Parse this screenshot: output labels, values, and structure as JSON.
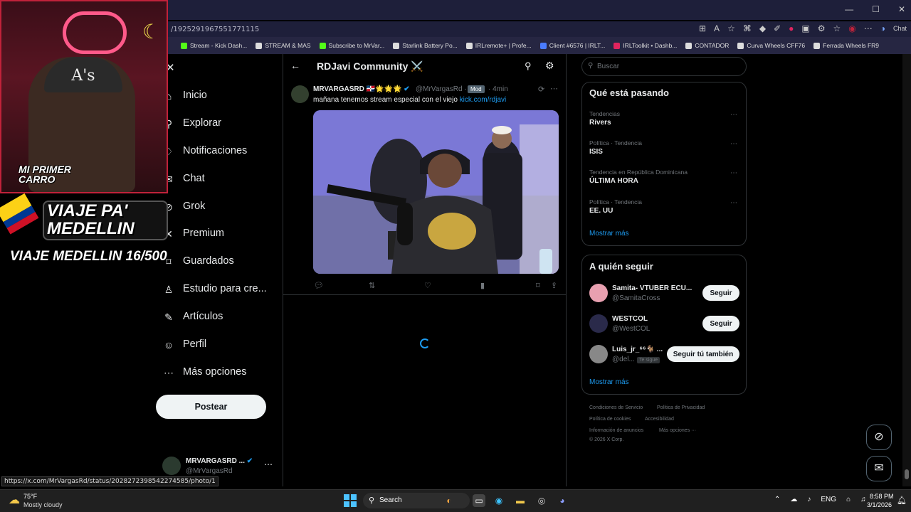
{
  "browser": {
    "url": "/1925291967551771115",
    "window_controls": [
      "—",
      "☐",
      "✕"
    ],
    "chat_label": "Chat",
    "bookmarks": [
      {
        "label": "Stream - Kick Dash...",
        "color": "#53fc18"
      },
      {
        "label": "STREAM & MAS",
        "color": "#dddddd"
      },
      {
        "label": "Subscribe to MrVar...",
        "color": "#53fc18"
      },
      {
        "label": "Starlink Battery Po...",
        "color": "#dddddd"
      },
      {
        "label": "IRLremote+ | Profe...",
        "color": "#dddddd"
      },
      {
        "label": "Client #6576 | IRLT...",
        "color": "#4a7cff"
      },
      {
        "label": "IRLToolkit • Dashb...",
        "color": "#e0245e"
      },
      {
        "label": "CONTADOR",
        "color": "#dddddd"
      },
      {
        "label": "Curva Wheels CFF76",
        "color": "#dddddd"
      },
      {
        "label": "Ferrada Wheels FR9",
        "color": "#dddddd"
      }
    ]
  },
  "nav": {
    "items": [
      {
        "label": "Inicio",
        "icon": "home-icon",
        "glyph": "⌂"
      },
      {
        "label": "Explorar",
        "icon": "search-icon",
        "glyph": "⚲"
      },
      {
        "label": "Notificaciones",
        "icon": "bell-icon",
        "glyph": "♢"
      },
      {
        "label": "Chat",
        "icon": "chat-icon",
        "glyph": "✉"
      },
      {
        "label": "Grok",
        "icon": "grok-icon",
        "glyph": "⊘"
      },
      {
        "label": "Premium",
        "icon": "x-premium-icon",
        "glyph": "✕"
      },
      {
        "label": "Guardados",
        "icon": "bookmark-icon",
        "glyph": "⌑"
      },
      {
        "label": "Estudio para cre...",
        "icon": "studio-icon",
        "glyph": "♙"
      },
      {
        "label": "Artículos",
        "icon": "article-icon",
        "glyph": "✎"
      },
      {
        "label": "Perfil",
        "icon": "profile-icon",
        "glyph": "☺"
      },
      {
        "label": "Más opciones",
        "icon": "more-circle-icon",
        "glyph": "⋯"
      }
    ],
    "post_button": "Postear",
    "account": {
      "name": "MRVARGASRD ...",
      "handle": "@MrVargasRd"
    }
  },
  "community": {
    "title": "RDJavi Community ⚔️",
    "post": {
      "author": "MRVARGASRD 🇩🇴🌟🌟🌟",
      "handle": "@MrVargasRd ·",
      "badge": "Mod",
      "time": "· 4min",
      "text": "mañana tenemos stream especial con el viejo ",
      "link": "kick.com/rdjavi"
    }
  },
  "right": {
    "search_placeholder": "Buscar",
    "trends_title": "Qué está pasando",
    "trends": [
      {
        "category": "Tendencias",
        "name": "Rivers"
      },
      {
        "category": "Política · Tendencia",
        "name": "ISIS"
      },
      {
        "category": "Tendencia en República Dominicana",
        "name": "ÚLTIMA HORA"
      },
      {
        "category": "Política · Tendencia",
        "name": "EE. UU"
      }
    ],
    "show_more": "Mostrar más",
    "follow_title": "A quién seguir",
    "follow": [
      {
        "name": "Samita- VTUBER ECU...",
        "handle": "@SamitaCross",
        "button": "Seguir",
        "color": "#e8a0b0"
      },
      {
        "name": "WESTCOL",
        "handle": "@WestCOL",
        "button": "Seguir",
        "color": "#2a2a4a"
      },
      {
        "name": "Luis_jr_⁶⁶🐐 ...",
        "handle": "@del...",
        "badge": "Te sigue",
        "button": "Seguir tú también",
        "color": "#888888"
      }
    ],
    "footer": [
      "Condiciones de Servicio",
      "Política de Privacidad",
      "Política de cookies",
      "Accesibilidad",
      "Información de anuncios",
      "Más opciones ···",
      "© 2026 X Corp."
    ]
  },
  "status_url": "https://x.com/MrVargasRd/status/2028272398542274585/photo/1",
  "overlay": {
    "cam_label": "MI PRIMER CARRO",
    "hat_text": "A's",
    "banner": "VIAJE PA' MEDELLIN",
    "counter": "VIAJE MEDELLIN 16/500"
  },
  "taskbar": {
    "temp": "75°F",
    "weather": "Mostly cloudy",
    "search": "Search",
    "lang": "ENG",
    "time": "8:58 PM",
    "date": "3/1/2026"
  }
}
